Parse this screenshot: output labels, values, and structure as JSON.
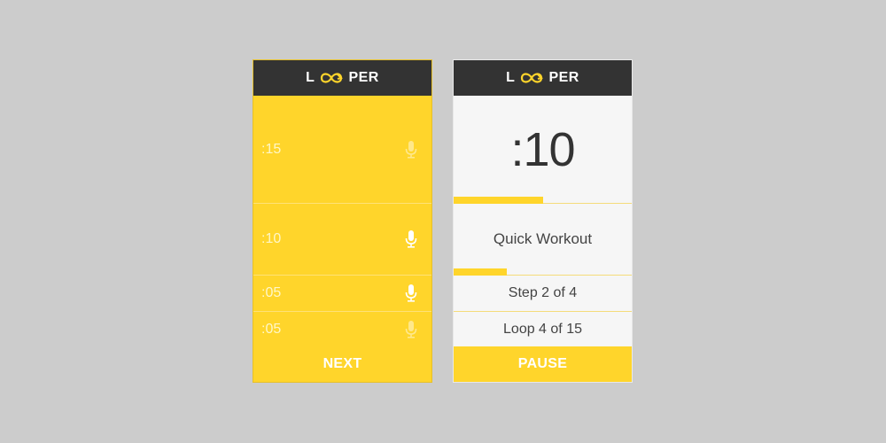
{
  "app": {
    "logo_left": "L",
    "logo_right": "PER",
    "logo_icon": "infinity-loop-icon",
    "accent_color": "#ffd52b",
    "header_color": "#333333"
  },
  "setup_screen": {
    "intervals": [
      {
        "time": ":15",
        "mic_active": false
      },
      {
        "time": ":10",
        "mic_active": true
      },
      {
        "time": ":05",
        "mic_active": true
      },
      {
        "time": ":05",
        "mic_active": false
      }
    ],
    "next_label": "NEXT"
  },
  "run_screen": {
    "timer": ":10",
    "timer_progress": 0.5,
    "workout_name": "Quick Workout",
    "workout_progress": 0.3,
    "step_text": "Step 2 of 4",
    "loop_text": "Loop 4 of 15",
    "pause_label": "PAUSE"
  }
}
